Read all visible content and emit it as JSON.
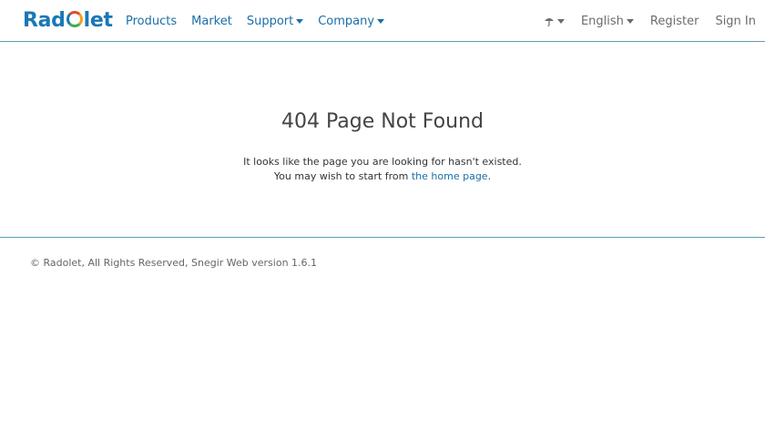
{
  "brand": {
    "name_pre": "Rad",
    "name_post": "let",
    "color": "#1a78b5"
  },
  "nav": {
    "products": "Products",
    "market": "Market",
    "support": "Support",
    "company": "Company"
  },
  "nav_right": {
    "theme_icon": "umbrella-icon",
    "language": "English",
    "register": "Register",
    "sign_in": "Sign In"
  },
  "content": {
    "title": "404 Page Not Found",
    "line1": "It looks like the page you are looking for hasn't existed.",
    "line2_pre": "You may wish to start from ",
    "line2_link": "the home page",
    "line2_post": "."
  },
  "footer": {
    "text": "© Radolet, All Rights Reserved, Snegir Web version 1.6.1"
  },
  "colors": {
    "link": "#1a6fa8",
    "divider": "#5c9ebd",
    "muted": "#6c6c6c"
  }
}
